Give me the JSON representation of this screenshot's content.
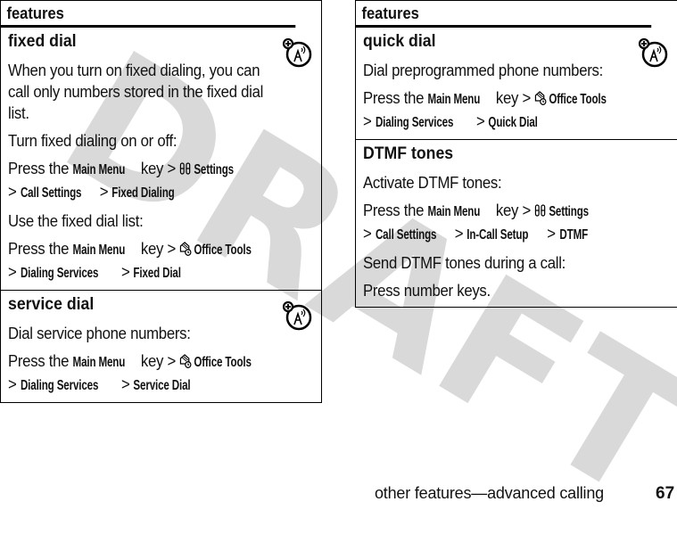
{
  "watermark": "DRAFT",
  "left_table": {
    "header": "features",
    "rows": [
      {
        "title": "fixed dial",
        "network_icon": "network-feature-icon",
        "paragraphs": [
          "When you turn on fixed dialing, you can call only numbers stored in the fixed dial list.",
          "Turn fixed dialing on or off:"
        ],
        "nav1": {
          "prefix": "Press the ",
          "key": "Main Menu",
          "mid": " key > ",
          "icon": "settings-icon",
          "menu": "Settings",
          "line2": [
            "Call Settings",
            "Fixed Dialing"
          ]
        },
        "para3": "Use the fixed dial list:",
        "nav2": {
          "prefix": "Press the ",
          "key": "Main Menu",
          "mid": " key > ",
          "icon": "office-tools-icon",
          "menu": "Office Tools",
          "line2": [
            "Dialing Services",
            "Fixed Dial"
          ]
        }
      },
      {
        "title": "service dial",
        "network_icon": "network-feature-icon",
        "paragraphs": [
          "Dial service phone numbers:"
        ],
        "nav1": {
          "prefix": "Press the ",
          "key": "Main Menu",
          "mid": " key > ",
          "icon": "office-tools-icon",
          "menu": "Office Tools",
          "line2": [
            "Dialing Services",
            "Service Dial"
          ]
        }
      }
    ]
  },
  "right_table": {
    "header": "features",
    "rows": [
      {
        "title": "quick dial",
        "network_icon": "network-feature-icon",
        "paragraphs": [
          "Dial preprogrammed phone numbers:"
        ],
        "nav1": {
          "prefix": "Press the ",
          "key": "Main Menu",
          "mid": " key > ",
          "icon": "office-tools-icon",
          "menu": "Office Tools",
          "line2": [
            "Dialing Services",
            "Quick Dial"
          ]
        }
      },
      {
        "title": "DTMF tones",
        "paragraphs": [
          "Activate DTMF tones:"
        ],
        "nav1": {
          "prefix": "Press the ",
          "key": "Main Menu",
          "mid": " key > ",
          "icon": "settings-icon",
          "menu": "Settings",
          "line2": [
            "Call Settings",
            "In-Call Setup",
            "DTMF"
          ]
        },
        "para3": "Send DTMF tones during a call:",
        "para4": "Press number keys."
      }
    ]
  },
  "footer": {
    "section": "other features—advanced calling",
    "page_number": "67"
  },
  "colors": {
    "text": "#111111",
    "rule": "#000000",
    "watermark": "#d9d9d9"
  },
  "separator": ">"
}
